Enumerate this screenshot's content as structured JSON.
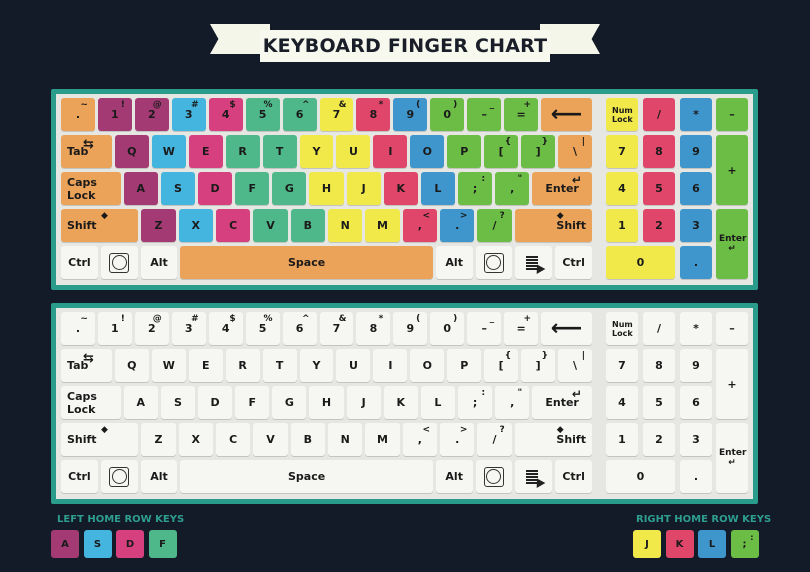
{
  "title": "KEYBOARD FINGER CHART",
  "colors": {
    "background": "#131a28",
    "frame": "#2a9c8c",
    "left_pinky": "#a43a73",
    "left_ring": "#44b5de",
    "left_middle": "#d6407f",
    "left_index": "#4fb88a",
    "right_index": "#f1e94a",
    "right_middle": "#e0466a",
    "right_ring": "#3f96cc",
    "right_pinky": "#6cbd45",
    "thumb_modifier": "#eba259",
    "neutral": "#f6f6f2"
  },
  "rows": [
    [
      {
        "id": "tilde",
        "label": ".",
        "shift": "~",
        "finger": "thumb_modifier",
        "w": 1
      },
      {
        "id": "1",
        "label": "1",
        "shift": "!",
        "finger": "left_pinky",
        "w": 1
      },
      {
        "id": "2",
        "label": "2",
        "shift": "@",
        "finger": "left_pinky",
        "w": 1
      },
      {
        "id": "3",
        "label": "3",
        "shift": "#",
        "finger": "left_ring",
        "w": 1
      },
      {
        "id": "4",
        "label": "4",
        "shift": "$",
        "finger": "left_middle",
        "w": 1
      },
      {
        "id": "5",
        "label": "5",
        "shift": "%",
        "finger": "left_index",
        "w": 1
      },
      {
        "id": "6",
        "label": "6",
        "shift": "^",
        "finger": "left_index",
        "w": 1
      },
      {
        "id": "7",
        "label": "7",
        "shift": "&",
        "finger": "right_index",
        "w": 1
      },
      {
        "id": "8",
        "label": "8",
        "shift": "*",
        "finger": "right_middle",
        "w": 1
      },
      {
        "id": "9",
        "label": "9",
        "shift": "(",
        "finger": "right_ring",
        "w": 1
      },
      {
        "id": "0",
        "label": "0",
        "shift": ")",
        "finger": "right_pinky",
        "w": 1
      },
      {
        "id": "minus",
        "label": "–",
        "shift": "_",
        "finger": "right_pinky",
        "w": 1
      },
      {
        "id": "equals",
        "label": "=",
        "shift": "+",
        "finger": "right_pinky",
        "w": 1
      },
      {
        "id": "backspace",
        "label": "⟵",
        "shift": "",
        "finger": "thumb_modifier",
        "w": 1.5
      }
    ],
    [
      {
        "id": "tab",
        "label": "Tab",
        "shift": "⇆",
        "finger": "thumb_modifier",
        "w": 1.5,
        "align": "left"
      },
      {
        "id": "q",
        "label": "Q",
        "shift": "",
        "finger": "left_pinky",
        "w": 1
      },
      {
        "id": "w",
        "label": "W",
        "shift": "",
        "finger": "left_ring",
        "w": 1
      },
      {
        "id": "e",
        "label": "E",
        "shift": "",
        "finger": "left_middle",
        "w": 1
      },
      {
        "id": "r",
        "label": "R",
        "shift": "",
        "finger": "left_index",
        "w": 1
      },
      {
        "id": "t",
        "label": "T",
        "shift": "",
        "finger": "left_index",
        "w": 1
      },
      {
        "id": "y",
        "label": "Y",
        "shift": "",
        "finger": "right_index",
        "w": 1
      },
      {
        "id": "u",
        "label": "U",
        "shift": "",
        "finger": "right_index",
        "w": 1
      },
      {
        "id": "i",
        "label": "I",
        "shift": "",
        "finger": "right_middle",
        "w": 1
      },
      {
        "id": "o",
        "label": "O",
        "shift": "",
        "finger": "right_ring",
        "w": 1
      },
      {
        "id": "p",
        "label": "P",
        "shift": "",
        "finger": "right_pinky",
        "w": 1
      },
      {
        "id": "lbracket",
        "label": "[",
        "shift": "{",
        "finger": "right_pinky",
        "w": 1
      },
      {
        "id": "rbracket",
        "label": "]",
        "shift": "}",
        "finger": "right_pinky",
        "w": 1
      },
      {
        "id": "backslash",
        "label": "\\",
        "shift": "|",
        "finger": "thumb_modifier",
        "w": 1
      }
    ],
    [
      {
        "id": "capslock",
        "label": "Caps Lock",
        "shift": "",
        "finger": "thumb_modifier",
        "w": 1.75,
        "align": "left"
      },
      {
        "id": "a",
        "label": "A",
        "shift": "",
        "finger": "left_pinky",
        "w": 1
      },
      {
        "id": "s",
        "label": "S",
        "shift": "",
        "finger": "left_ring",
        "w": 1
      },
      {
        "id": "d",
        "label": "D",
        "shift": "",
        "finger": "left_middle",
        "w": 1
      },
      {
        "id": "f",
        "label": "F",
        "shift": "",
        "finger": "left_index",
        "w": 1
      },
      {
        "id": "g",
        "label": "G",
        "shift": "",
        "finger": "left_index",
        "w": 1
      },
      {
        "id": "h",
        "label": "H",
        "shift": "",
        "finger": "right_index",
        "w": 1
      },
      {
        "id": "j",
        "label": "J",
        "shift": "",
        "finger": "right_index",
        "w": 1
      },
      {
        "id": "k",
        "label": "K",
        "shift": "",
        "finger": "right_middle",
        "w": 1
      },
      {
        "id": "l",
        "label": "L",
        "shift": "",
        "finger": "right_ring",
        "w": 1
      },
      {
        "id": "semicolon",
        "label": ";",
        "shift": ":",
        "finger": "right_pinky",
        "w": 1
      },
      {
        "id": "quote",
        "label": ",",
        "shift": "\"",
        "finger": "right_pinky",
        "w": 1
      },
      {
        "id": "enter",
        "label": "Enter",
        "shift": "↵",
        "finger": "thumb_modifier",
        "w": 1.75
      }
    ],
    [
      {
        "id": "lshift",
        "label": "Shift",
        "shift": "◆",
        "finger": "thumb_modifier",
        "w": 2.25,
        "align": "left"
      },
      {
        "id": "z",
        "label": "Z",
        "shift": "",
        "finger": "left_pinky",
        "w": 1
      },
      {
        "id": "x",
        "label": "X",
        "shift": "",
        "finger": "left_ring",
        "w": 1
      },
      {
        "id": "c",
        "label": "C",
        "shift": "",
        "finger": "left_middle",
        "w": 1
      },
      {
        "id": "v",
        "label": "V",
        "shift": "",
        "finger": "left_index",
        "w": 1
      },
      {
        "id": "b",
        "label": "B",
        "shift": "",
        "finger": "left_index",
        "w": 1
      },
      {
        "id": "n",
        "label": "N",
        "shift": "",
        "finger": "right_index",
        "w": 1
      },
      {
        "id": "m",
        "label": "M",
        "shift": "",
        "finger": "right_index",
        "w": 1
      },
      {
        "id": "comma",
        "label": ",",
        "shift": "<",
        "finger": "right_middle",
        "w": 1
      },
      {
        "id": "period",
        "label": ".",
        "shift": ">",
        "finger": "right_ring",
        "w": 1
      },
      {
        "id": "slash",
        "label": "/",
        "shift": "?",
        "finger": "right_pinky",
        "w": 1
      },
      {
        "id": "rshift",
        "label": "Shift",
        "shift": "◆",
        "finger": "thumb_modifier",
        "w": 2.25,
        "align": "right"
      }
    ],
    [
      {
        "id": "lctrl",
        "label": "Ctrl",
        "shift": "",
        "finger": "neutral",
        "w": 1.05
      },
      {
        "id": "lwin",
        "label": "",
        "icon": "win",
        "shift": "",
        "finger": "neutral",
        "w": 1.05
      },
      {
        "id": "lalt",
        "label": "Alt",
        "shift": "",
        "finger": "neutral",
        "w": 1.05
      },
      {
        "id": "space",
        "label": "Space",
        "shift": "",
        "finger": "thumb_modifier",
        "w": 7.2
      },
      {
        "id": "ralt",
        "label": "Alt",
        "shift": "",
        "finger": "neutral",
        "w": 1.05
      },
      {
        "id": "rwin",
        "label": "",
        "icon": "win",
        "shift": "",
        "finger": "neutral",
        "w": 1.05
      },
      {
        "id": "menu",
        "label": "",
        "icon": "menu",
        "shift": "",
        "finger": "neutral",
        "w": 1.05
      },
      {
        "id": "rctrl",
        "label": "Ctrl",
        "shift": "",
        "finger": "neutral",
        "w": 1.05
      }
    ]
  ],
  "numpad": [
    {
      "id": "numlock",
      "label": "Num Lock",
      "finger": "right_index",
      "c": 0,
      "r": 0,
      "cw": 1,
      "rh": 1
    },
    {
      "id": "np-divide",
      "label": "/",
      "finger": "right_middle",
      "c": 1,
      "r": 0,
      "cw": 1,
      "rh": 1
    },
    {
      "id": "np-multiply",
      "label": "*",
      "finger": "right_ring",
      "c": 2,
      "r": 0,
      "cw": 1,
      "rh": 1
    },
    {
      "id": "np-minus",
      "label": "–",
      "finger": "right_pinky",
      "c": 3,
      "r": 0,
      "cw": 1,
      "rh": 1
    },
    {
      "id": "np-7",
      "label": "7",
      "finger": "right_index",
      "c": 0,
      "r": 1,
      "cw": 1,
      "rh": 1
    },
    {
      "id": "np-8",
      "label": "8",
      "finger": "right_middle",
      "c": 1,
      "r": 1,
      "cw": 1,
      "rh": 1
    },
    {
      "id": "np-9",
      "label": "9",
      "finger": "right_ring",
      "c": 2,
      "r": 1,
      "cw": 1,
      "rh": 1
    },
    {
      "id": "np-plus",
      "label": "+",
      "finger": "right_pinky",
      "c": 3,
      "r": 1,
      "cw": 1,
      "rh": 2
    },
    {
      "id": "np-4",
      "label": "4",
      "finger": "right_index",
      "c": 0,
      "r": 2,
      "cw": 1,
      "rh": 1
    },
    {
      "id": "np-5",
      "label": "5",
      "finger": "right_middle",
      "c": 1,
      "r": 2,
      "cw": 1,
      "rh": 1
    },
    {
      "id": "np-6",
      "label": "6",
      "finger": "right_ring",
      "c": 2,
      "r": 2,
      "cw": 1,
      "rh": 1
    },
    {
      "id": "np-1",
      "label": "1",
      "finger": "right_index",
      "c": 0,
      "r": 3,
      "cw": 1,
      "rh": 1
    },
    {
      "id": "np-2",
      "label": "2",
      "finger": "right_middle",
      "c": 1,
      "r": 3,
      "cw": 1,
      "rh": 1
    },
    {
      "id": "np-3",
      "label": "3",
      "finger": "right_ring",
      "c": 2,
      "r": 3,
      "cw": 1,
      "rh": 1
    },
    {
      "id": "np-enter",
      "label": "Enter ↵",
      "finger": "right_pinky",
      "c": 3,
      "r": 3,
      "cw": 1,
      "rh": 2
    },
    {
      "id": "np-0",
      "label": "0",
      "finger": "right_index",
      "c": 0,
      "r": 4,
      "cw": 2,
      "rh": 1
    },
    {
      "id": "np-decimal",
      "label": ".",
      "finger": "right_ring",
      "c": 2,
      "r": 4,
      "cw": 1,
      "rh": 1
    }
  ],
  "legend": {
    "left_title": "LEFT HOME ROW KEYS",
    "left_keys": [
      {
        "label": "A",
        "finger": "left_pinky"
      },
      {
        "label": "S",
        "finger": "left_ring"
      },
      {
        "label": "D",
        "finger": "left_middle"
      },
      {
        "label": "F",
        "finger": "left_index"
      }
    ],
    "right_title": "RIGHT HOME ROW KEYS",
    "right_keys": [
      {
        "label": "J",
        "finger": "right_index"
      },
      {
        "label": "K",
        "finger": "right_middle"
      },
      {
        "label": "L",
        "finger": "right_ring"
      },
      {
        "label": ";",
        "shift": ":",
        "finger": "right_pinky"
      }
    ]
  }
}
